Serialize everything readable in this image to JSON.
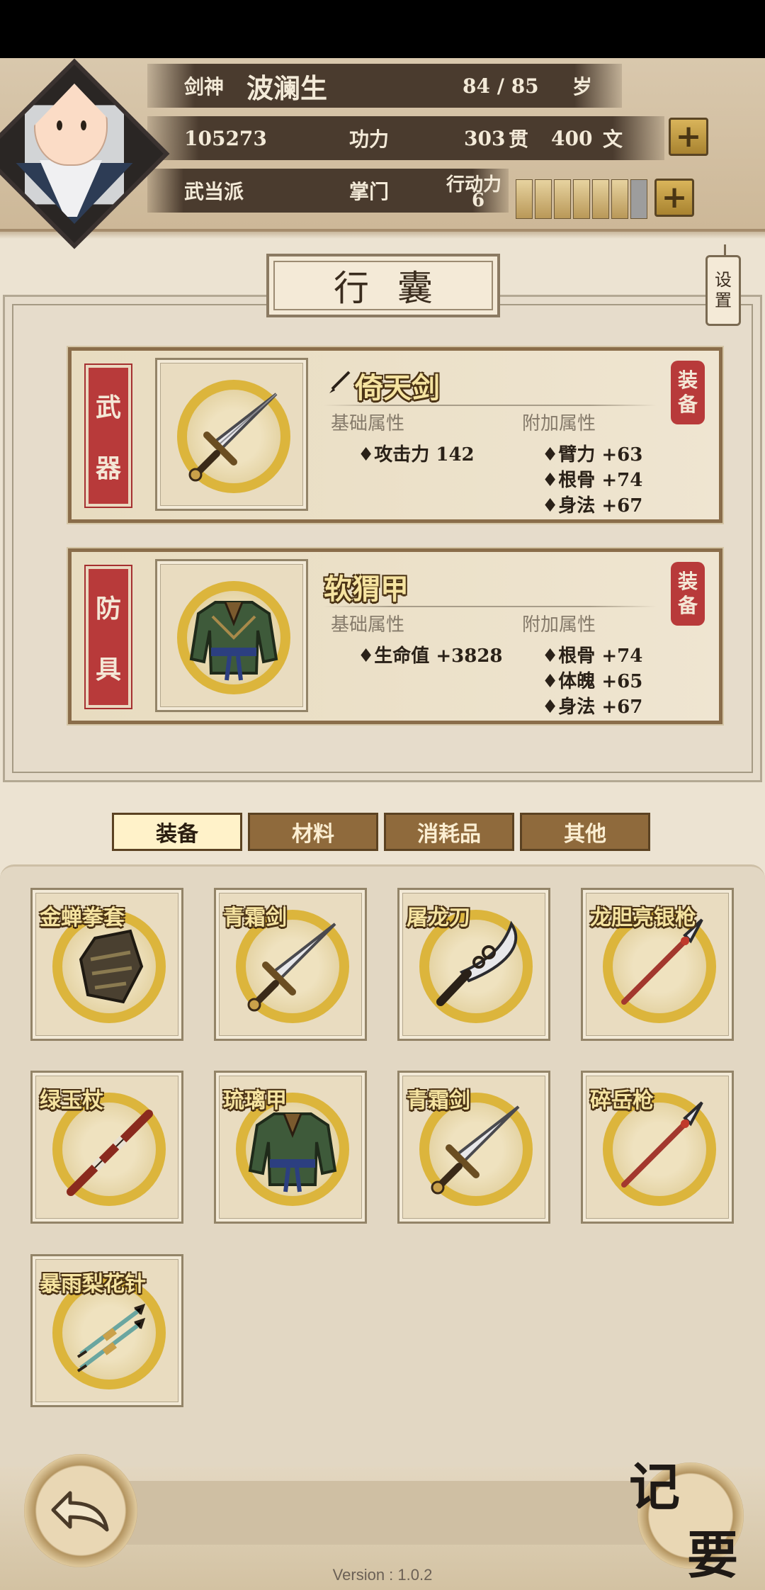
{
  "player": {
    "title": "剑神",
    "name": "波澜生",
    "age": "84 / 85",
    "age_unit": "岁",
    "power_value": "105273",
    "power_label": "功力",
    "money_guan": "303",
    "guan_unit": "贯",
    "money_wen": "400",
    "wen_unit": "文",
    "sect": "武当派",
    "rank": "掌门",
    "action_label": "行动力",
    "action_value": "6",
    "action_filled": 6,
    "action_total": 7
  },
  "plus_symbol": "+",
  "panel": {
    "title": "行囊",
    "settings_label_1": "设",
    "settings_label_2": "置"
  },
  "equipped": [
    {
      "slot_1": "武",
      "slot_2": "器",
      "name": "倚天剑",
      "icon": "sword",
      "base_label": "基础属性",
      "extra_label": "附加属性",
      "base": [
        "♦攻击力 142"
      ],
      "extra": [
        "♦臂力 +63",
        "♦根骨 +74",
        "♦身法 +67"
      ],
      "badge_1": "装",
      "badge_2": "备"
    },
    {
      "slot_1": "防",
      "slot_2": "具",
      "name": "软猬甲",
      "icon": "armor",
      "base_label": "基础属性",
      "extra_label": "附加属性",
      "base": [
        "♦生命值 +3828"
      ],
      "extra": [
        "♦根骨 +74",
        "♦体魄 +65",
        "♦身法 +67"
      ],
      "badge_1": "装",
      "badge_2": "备"
    }
  ],
  "tabs": [
    "装备",
    "材料",
    "消耗品",
    "其他"
  ],
  "active_tab": 0,
  "inventory": [
    {
      "name": "金蝉拳套",
      "icon": "gauntlet"
    },
    {
      "name": "青霜剑",
      "icon": "sword"
    },
    {
      "name": "屠龙刀",
      "icon": "saber"
    },
    {
      "name": "龙胆亮银枪",
      "icon": "spear"
    },
    {
      "name": "绿玉杖",
      "icon": "staff"
    },
    {
      "name": "琉璃甲",
      "icon": "armor"
    },
    {
      "name": "青霜剑",
      "icon": "sword"
    },
    {
      "name": "碎岳枪",
      "icon": "spear"
    },
    {
      "name": "暴雨梨花针",
      "icon": "needles"
    }
  ],
  "memo_1": "记",
  "memo_2": "要",
  "version": "Version : 1.0.2"
}
